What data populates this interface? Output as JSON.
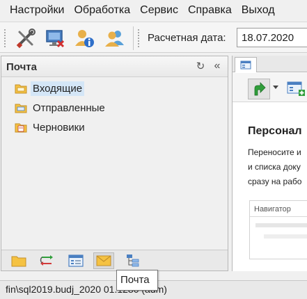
{
  "menu": {
    "items": [
      "Настройки",
      "Обработка",
      "Сервис",
      "Справка",
      "Выход"
    ]
  },
  "toolbar": {
    "buttons": [
      "settings-tools-icon",
      "disconnect-computer-icon",
      "user-info-icon",
      "users-icon"
    ],
    "date_label": "Расчетная дата:",
    "date_value": "18.07.2020"
  },
  "mail_panel": {
    "title": "Почта",
    "folders": [
      {
        "label": "Входящие",
        "icon": "inbox-folder-icon",
        "selected": true
      },
      {
        "label": "Отправленные",
        "icon": "sent-folder-icon",
        "selected": false
      },
      {
        "label": "Черновики",
        "icon": "drafts-folder-icon",
        "selected": false
      }
    ],
    "nav_buttons": [
      "folder-icon",
      "workflow-icon",
      "list-view-icon",
      "mail-icon",
      "tree-icon"
    ],
    "active_nav": 3
  },
  "right_panel": {
    "heading": "Персонал",
    "text_lines": [
      "Переносите и",
      "и списка доку",
      "сразу на рабо"
    ],
    "navigator_title": "Навигатор"
  },
  "statusbar": {
    "text": "fin\\sql2019.budj_2020     01.1280 (adm)"
  },
  "tooltip": {
    "text": "Почта"
  },
  "colors": {
    "selection": "#d4e6f7",
    "folder_yellow": "#f5c242",
    "accent_green": "#2f9e3a"
  }
}
